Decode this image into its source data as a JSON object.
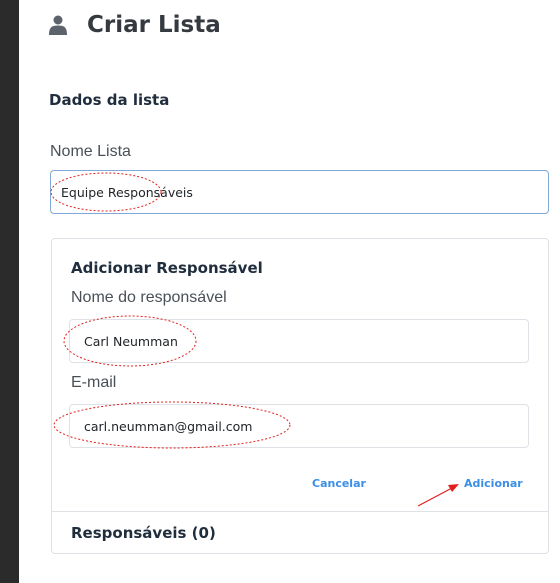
{
  "header": {
    "title": "Criar Lista",
    "icon": "user-icon"
  },
  "list_section": {
    "title": "Dados da lista",
    "name_label": "Nome Lista",
    "name_value": "Equipe Responsáveis"
  },
  "add_card": {
    "title": "Adicionar Responsável",
    "name_label": "Nome do responsável",
    "name_value": "Carl Neumman",
    "email_label": "E-mail",
    "email_value": "carl.neumman@gmail.com",
    "cancel_label": "Cancelar",
    "add_label": "Adicionar"
  },
  "responsaveis": {
    "title": "Responsáveis (0)"
  },
  "colors": {
    "link": "#3a8ee6",
    "annotation": "#e0201b",
    "sidebar": "#2b2b2b"
  }
}
